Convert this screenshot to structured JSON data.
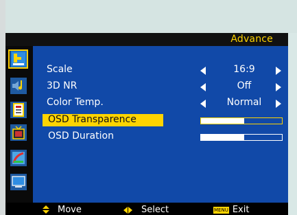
{
  "header": {
    "title": "Advance"
  },
  "sidebar": {
    "icons": [
      {
        "name": "picture-icon",
        "selected": true
      },
      {
        "name": "sound-icon",
        "selected": false
      },
      {
        "name": "function-icon",
        "selected": false
      },
      {
        "name": "tv-icon",
        "selected": false
      },
      {
        "name": "chart-icon",
        "selected": false
      },
      {
        "name": "monitor-icon",
        "selected": false
      }
    ]
  },
  "menu": {
    "items": [
      {
        "label": "Scale",
        "value": "16:9"
      },
      {
        "label": "3D NR",
        "value": "Off"
      },
      {
        "label": "Color Temp.",
        "value": "Normal"
      },
      {
        "label": "OSD Transparence",
        "level": 0.53,
        "selected": true
      },
      {
        "label": "OSD Duration",
        "level": 0.53
      }
    ]
  },
  "footer": {
    "move_label": "Move",
    "select_label": "Select",
    "exit_badge": "MENU",
    "exit_label": "Exit"
  },
  "colors": {
    "panel": "#1149a8",
    "accent": "#ffd400",
    "header": "#111111",
    "sidebar": "#0a0a0a"
  }
}
